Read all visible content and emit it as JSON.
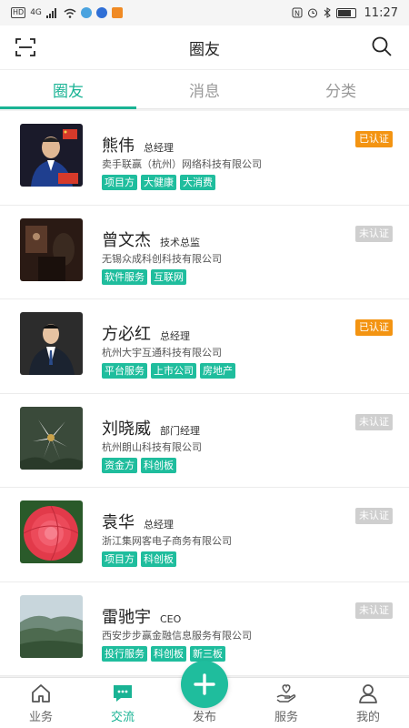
{
  "status_bar": {
    "left_badge": "HD",
    "network": "4G",
    "time": "11:27"
  },
  "header": {
    "title": "圈友",
    "scan_icon": "scan-icon",
    "search_icon": "search-icon"
  },
  "tabs": [
    {
      "label": "圈友",
      "active": true
    },
    {
      "label": "消息",
      "active": false
    },
    {
      "label": "分类",
      "active": false
    }
  ],
  "users": [
    {
      "name": "熊伟",
      "title": "总经理",
      "company": "卖手联赢（杭州）网络科技有限公司",
      "tags": [
        "项目方",
        "大健康",
        "大消费"
      ],
      "status": "已认证",
      "verified": true
    },
    {
      "name": "曾文杰",
      "title": "技术总监",
      "company": "无锡众成科创科技有限公司",
      "tags": [
        "软件服务",
        "互联网"
      ],
      "status": "未认证",
      "verified": false
    },
    {
      "name": "方必红",
      "title": "总经理",
      "company": "杭州大宇互通科技有限公司",
      "tags": [
        "平台服务",
        "上市公司",
        "房地产"
      ],
      "status": "已认证",
      "verified": true
    },
    {
      "name": "刘晓威",
      "title": "部门经理",
      "company": "杭州朗山科技有限公司",
      "tags": [
        "资金方",
        "科创板"
      ],
      "status": "未认证",
      "verified": false
    },
    {
      "name": "袁华",
      "title": "总经理",
      "company": "浙江集网客电子商务有限公司",
      "tags": [
        "项目方",
        "科创板"
      ],
      "status": "未认证",
      "verified": false
    },
    {
      "name": "雷驰宇",
      "title": "CEO",
      "company": "西安步步赢金融信息服务有限公司",
      "tags": [
        "投行服务",
        "科创板",
        "新三板"
      ],
      "status": "未认证",
      "verified": false
    }
  ],
  "bottom_nav": [
    {
      "label": "业务",
      "icon": "home-icon",
      "active": false
    },
    {
      "label": "交流",
      "icon": "chat-icon",
      "active": true
    },
    {
      "label": "发布",
      "icon": "plus-icon",
      "active": false
    },
    {
      "label": "服务",
      "icon": "service-icon",
      "active": false
    },
    {
      "label": "我的",
      "icon": "profile-icon",
      "active": false
    }
  ],
  "colors": {
    "accent": "#19b394",
    "tag": "#1fbd9d",
    "verified": "#f39412",
    "unverified": "#cfcfcf"
  }
}
